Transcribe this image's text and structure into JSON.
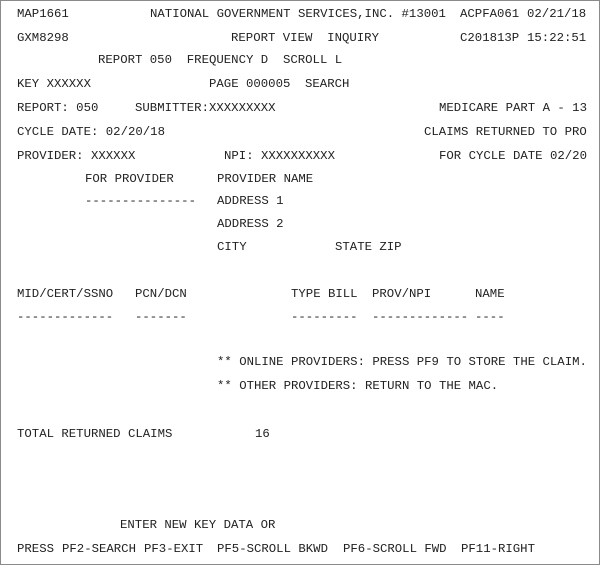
{
  "header": {
    "map_id": "MAP1661",
    "company": "NATIONAL GOVERNMENT SERVICES,INC. #13001",
    "system_id": "ACPFA061",
    "date": "02/21/18",
    "user_id": "GXM8298",
    "screen_title": "REPORT VIEW  INQUIRY",
    "terminal_id": "C201813P",
    "time": "15:22:51",
    "report_line": "REPORT 050  FREQUENCY D  SCROLL L",
    "key": "KEY XXXXXX",
    "page": "PAGE 000005",
    "search": "SEARCH"
  },
  "report": {
    "report_no": "REPORT: 050",
    "submitter": "SUBMITTER:XXXXXXXXX",
    "program": "MEDICARE PART A - 13",
    "cycle_date": "CYCLE DATE: 02/20/18",
    "report_name": "CLAIMS RETURNED TO PRO",
    "provider": "PROVIDER: XXXXXX",
    "npi": "NPI: XXXXXXXXXX",
    "for_cycle": "FOR CYCLE DATE 02/20",
    "for_provider": "FOR PROVIDER",
    "for_provider_dashes": "---------------",
    "provider_name": "PROVIDER NAME",
    "address1": "ADDRESS 1",
    "address2": "ADDRESS 2",
    "city": "CITY",
    "state_zip": "STATE ZIP"
  },
  "table": {
    "columns": [
      {
        "label": "MID/CERT/SSNO",
        "dashes": "-------------"
      },
      {
        "label": "PCN/DCN",
        "dashes": "-------"
      },
      {
        "label": "TYPE BILL",
        "dashes": "---------"
      },
      {
        "label": "PROV/NPI",
        "dashes": "-------------"
      },
      {
        "label": "NAME",
        "dashes": "----"
      }
    ]
  },
  "messages": {
    "online": "** ONLINE PROVIDERS: PRESS PF9 TO STORE THE CLAIM.",
    "other": "** OTHER PROVIDERS: RETURN TO THE MAC."
  },
  "totals": {
    "label": "TOTAL RETURNED CLAIMS",
    "value": "16"
  },
  "footer": {
    "prompt": "ENTER NEW KEY DATA OR",
    "press": "PRESS",
    "keys": [
      "PF2-SEARCH",
      "PF3-EXIT",
      "PF5-SCROLL BKWD",
      "PF6-SCROLL FWD",
      "PF11-RIGHT"
    ]
  }
}
